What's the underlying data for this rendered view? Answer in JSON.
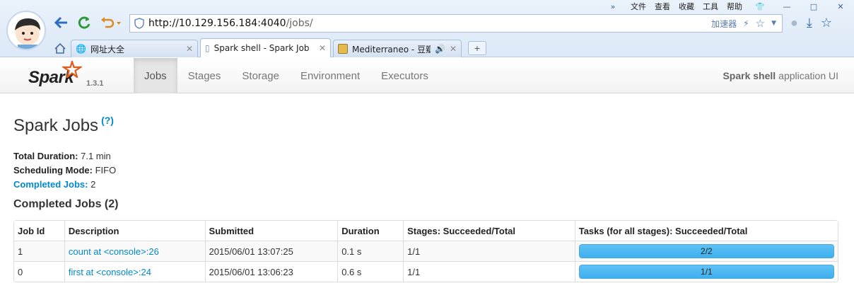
{
  "browser": {
    "menu": [
      "文件",
      "查看",
      "收藏",
      "工具",
      "帮助"
    ],
    "url_host": "http://10.129.156.184:4040",
    "url_path": "/jobs/",
    "accelerator": "加速器",
    "tabs": [
      {
        "title": "网址大全",
        "active": false
      },
      {
        "title": "Spark shell - Spark Job",
        "active": true
      },
      {
        "title": "Mediterraneo - 豆瓣",
        "active": false
      }
    ],
    "new_tab": "+"
  },
  "navbar": {
    "brand": "Spark",
    "version": "1.3.1",
    "tabs": [
      "Jobs",
      "Stages",
      "Storage",
      "Environment",
      "Executors"
    ],
    "active_tab": "Jobs",
    "app_name_bold": "Spark shell",
    "app_name_suffix": "application UI"
  },
  "page": {
    "title": "Spark Jobs",
    "help": "(?)",
    "summary": {
      "total_duration_label": "Total Duration:",
      "total_duration": "7.1 min",
      "scheduling_mode_label": "Scheduling Mode:",
      "scheduling_mode": "FIFO",
      "completed_jobs_label": "Completed Jobs:",
      "completed_jobs": "2"
    },
    "section_title": "Completed Jobs (2)",
    "table": {
      "headers": [
        "Job Id",
        "Description",
        "Submitted",
        "Duration",
        "Stages: Succeeded/Total",
        "Tasks (for all stages): Succeeded/Total"
      ],
      "rows": [
        {
          "job_id": "1",
          "description": "count at <console>:26",
          "submitted": "2015/06/01 13:07:25",
          "duration": "0.1 s",
          "stages": "1/1",
          "tasks": "2/2",
          "progress": 1.0
        },
        {
          "job_id": "0",
          "description": "first at <console>:24",
          "submitted": "2015/06/01 13:06:23",
          "duration": "0.6 s",
          "stages": "1/1",
          "tasks": "1/1",
          "progress": 1.0
        }
      ]
    }
  },
  "colors": {
    "link": "#0088cc",
    "progress": "#3db0ee",
    "spark_orange": "#e25a1c"
  }
}
